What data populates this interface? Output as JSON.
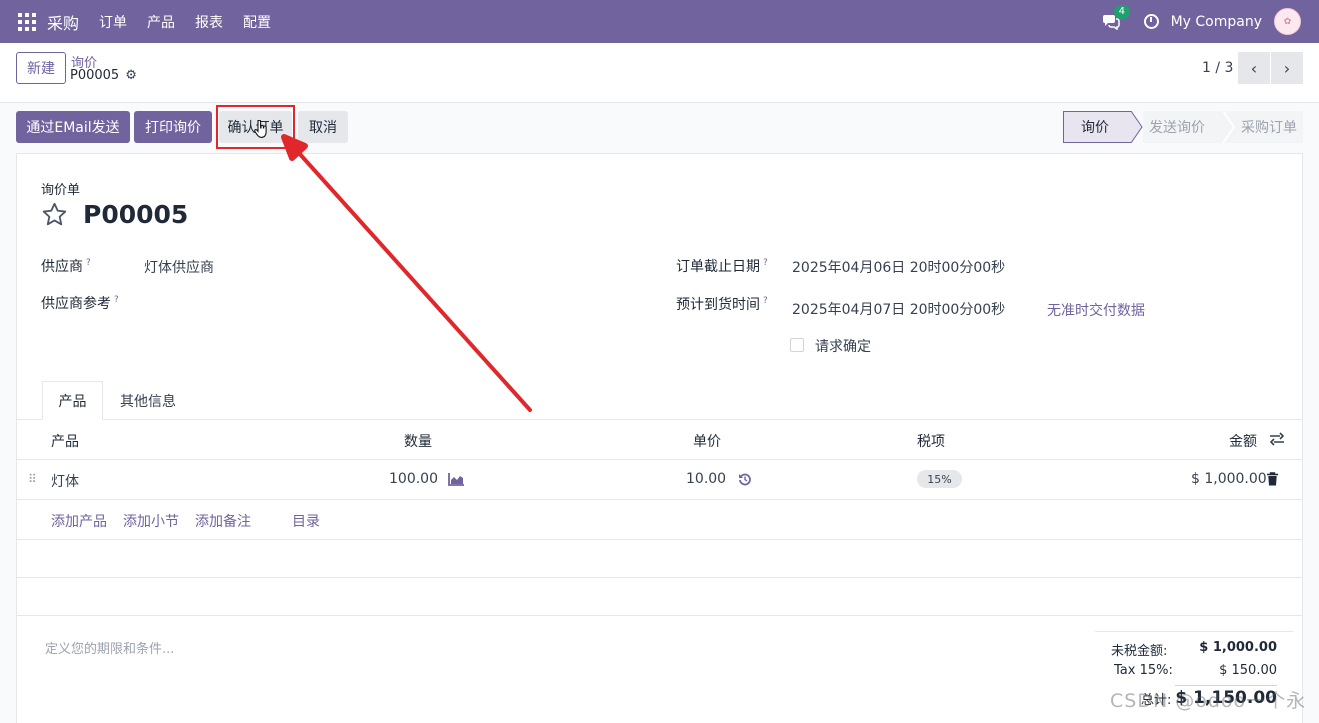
{
  "navbar": {
    "brand": "采购",
    "menu": [
      "订单",
      "产品",
      "报表",
      "配置"
    ],
    "chat_count": "4",
    "company": "My Company"
  },
  "control": {
    "new_label": "新建",
    "breadcrumb_parent": "询价",
    "breadcrumb_current": "P00005",
    "pager": "1 / 3"
  },
  "actions": {
    "send_email": "通过EMail发送",
    "print_rfq": "打印询价",
    "confirm_order": "确认订单",
    "cancel": "取消"
  },
  "status": [
    "询价",
    "发送询价",
    "采购订单"
  ],
  "form": {
    "doc_type": "询价单",
    "title": "P00005",
    "vendor_label": "供应商",
    "vendor_value": "灯体供应商",
    "vendor_ref_label": "供应商参考",
    "deadline_label": "订单截止日期",
    "deadline_value": "2025年04月06日 20时00分00秒",
    "expected_label": "预计到货时间",
    "expected_value": "2025年04月07日 20时00分00秒",
    "ontime_link": "无准时交付数据",
    "ack_label": "请求确定",
    "help_mark": "?"
  },
  "tabs": [
    "产品",
    "其他信息"
  ],
  "table": {
    "headers": [
      "产品",
      "数量",
      "单价",
      "税项",
      "金额"
    ],
    "rows": [
      {
        "product": "灯体",
        "qty": "100.00",
        "price": "10.00",
        "tax": "15%",
        "amount": "$ 1,000.00"
      }
    ],
    "add_links": [
      "添加产品",
      "添加小节",
      "添加备注",
      "目录"
    ]
  },
  "terms_placeholder": "定义您的期限和条件...",
  "totals": {
    "untaxed_label": "未税金额:",
    "untaxed_value": "$ 1,000.00",
    "tax_label": "Tax 15%:",
    "tax_value": "$ 150.00",
    "total_label": "总计:",
    "total_value": "$ 1,150.00"
  },
  "watermark": "CSDN @odoo一个永",
  "colors": {
    "brand": "#71639e",
    "highlight": "#e0272c"
  }
}
